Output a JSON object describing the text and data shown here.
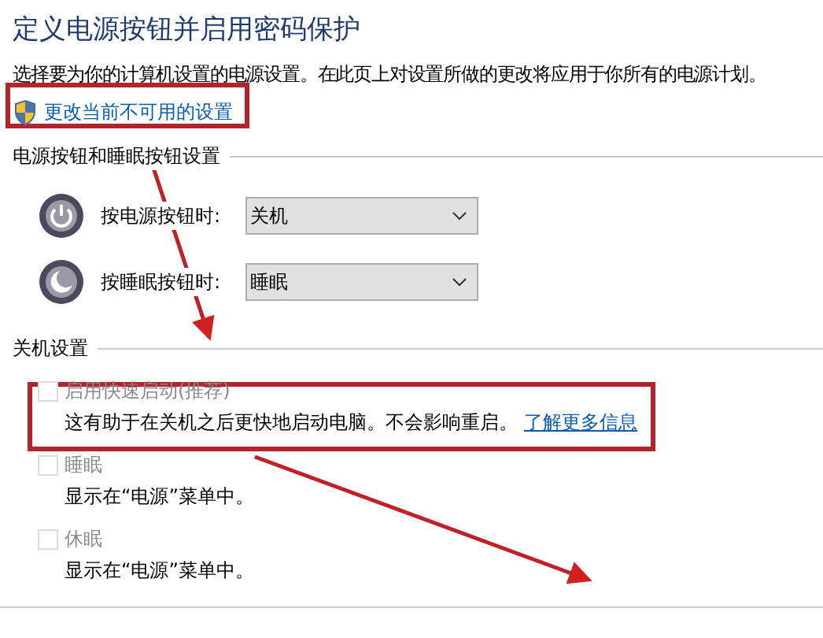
{
  "title": "定义电源按钮并启用密码保护",
  "description": "选择要为你的计算机设置的电源设置。在此页上对设置所做的更改将应用于你所有的电源计划。",
  "admin_link": "更改当前不可用的设置",
  "button_section": {
    "heading": "电源按钮和睡眠按钮设置",
    "rows": [
      {
        "kind": "power",
        "label": "按电源按钮时:",
        "value": "关机"
      },
      {
        "kind": "sleep",
        "label": "按睡眠按钮时:",
        "value": "睡眠"
      }
    ]
  },
  "shutdown_section": {
    "heading": "关机设置",
    "options": [
      {
        "label": "启用快速启动(推荐)",
        "checked": false,
        "disabled": true,
        "description": "这有助于在关机之后更快地启动电脑。不会影响重启。",
        "link": "了解更多信息"
      },
      {
        "label": "睡眠",
        "checked": false,
        "disabled": true,
        "description": "显示在“电源”菜单中。"
      },
      {
        "label": "休眠",
        "checked": false,
        "disabled": true,
        "description": "显示在“电源”菜单中。"
      }
    ]
  }
}
